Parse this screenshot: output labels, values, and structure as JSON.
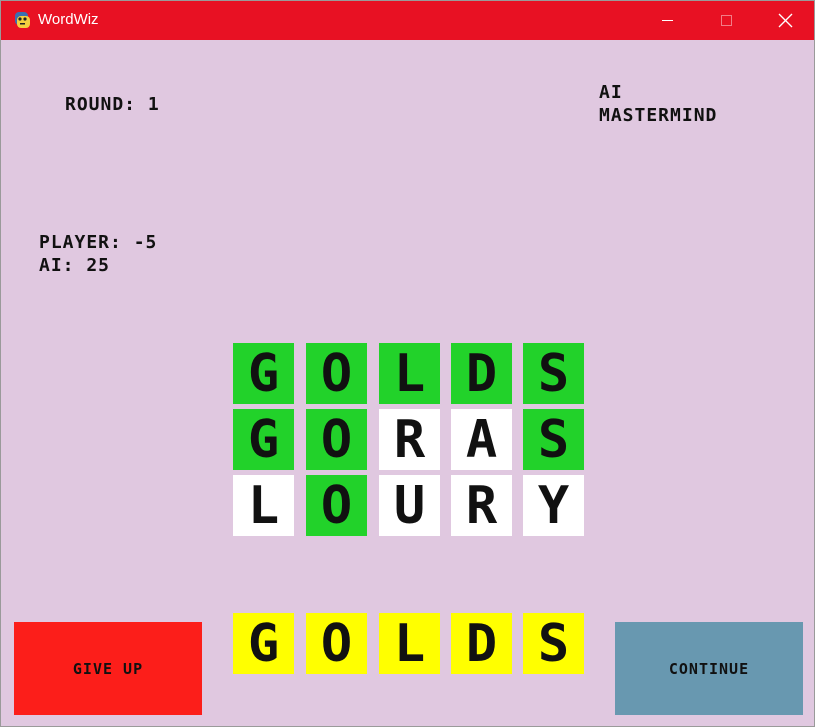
{
  "window": {
    "title": "WordWiz",
    "icon": "python-icon"
  },
  "colors": {
    "titlebar": "#e81123",
    "background": "#e0c8e0",
    "correct": "#22d22a",
    "absent": "#ffffff",
    "answer": "#ffff00",
    "give_up": "#fc1e1a",
    "continue": "#6898b0"
  },
  "header": {
    "round": "ROUND: 1",
    "mode_line1": "AI",
    "mode_line2": "MASTERMIND"
  },
  "scores": {
    "player": "PLAYER: -5",
    "ai": "AI: 25"
  },
  "guesses": [
    {
      "tiles": [
        {
          "letter": "G",
          "status": "green"
        },
        {
          "letter": "O",
          "status": "green"
        },
        {
          "letter": "L",
          "status": "green"
        },
        {
          "letter": "D",
          "status": "green"
        },
        {
          "letter": "S",
          "status": "green"
        }
      ]
    },
    {
      "tiles": [
        {
          "letter": "G",
          "status": "green"
        },
        {
          "letter": "O",
          "status": "green"
        },
        {
          "letter": "R",
          "status": "white"
        },
        {
          "letter": "A",
          "status": "white"
        },
        {
          "letter": "S",
          "status": "green"
        }
      ]
    },
    {
      "tiles": [
        {
          "letter": "L",
          "status": "white"
        },
        {
          "letter": "O",
          "status": "green"
        },
        {
          "letter": "U",
          "status": "white"
        },
        {
          "letter": "R",
          "status": "white"
        },
        {
          "letter": "Y",
          "status": "white"
        }
      ]
    }
  ],
  "answer": {
    "tiles": [
      {
        "letter": "G"
      },
      {
        "letter": "O"
      },
      {
        "letter": "L"
      },
      {
        "letter": "D"
      },
      {
        "letter": "S"
      }
    ]
  },
  "buttons": {
    "give_up": "GIVE UP",
    "continue": "CONTINUE"
  }
}
